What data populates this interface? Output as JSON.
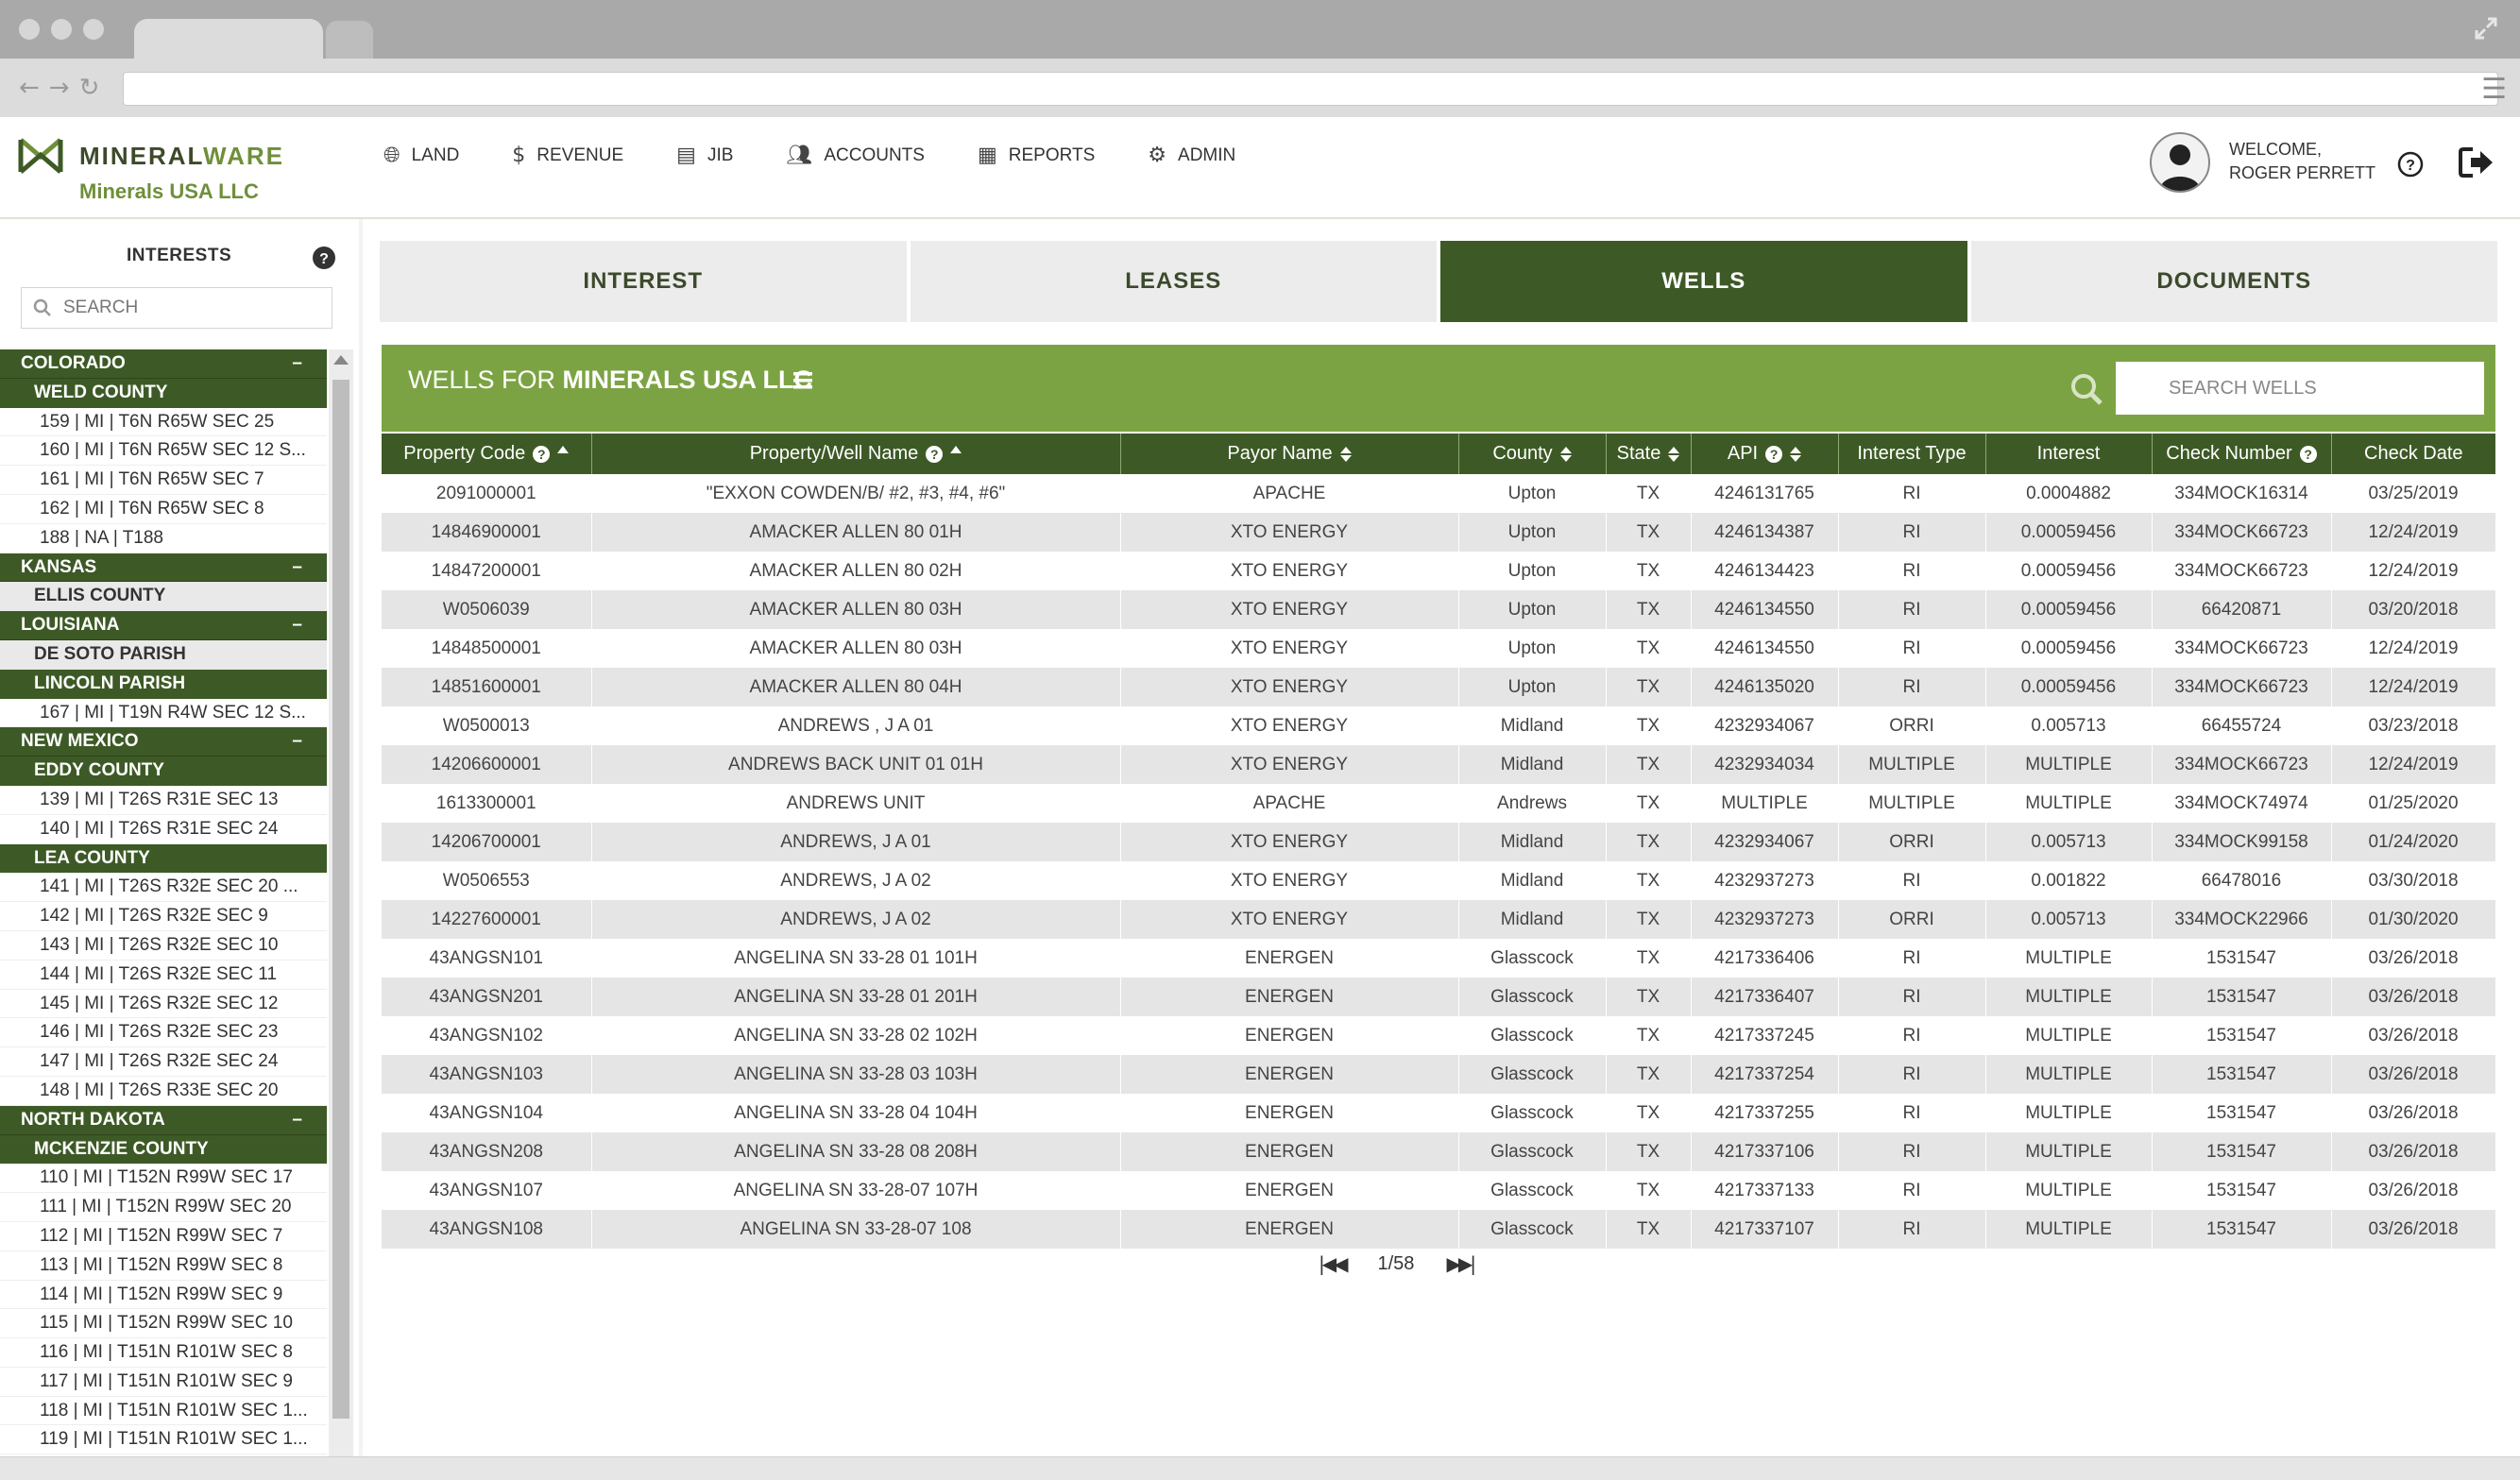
{
  "app": {
    "logo_text_a": "MINERAL",
    "logo_text_b": "WARE",
    "company": "Minerals USA LLC",
    "colors": {
      "primary_dark": "#3d5a26",
      "primary_light": "#7ca343",
      "accent_text": "#6f8f3a"
    }
  },
  "nav": [
    {
      "label": "LAND",
      "icon": "globe-icon"
    },
    {
      "label": "REVENUE",
      "icon": "dollar-icon"
    },
    {
      "label": "JIB",
      "icon": "file-icon"
    },
    {
      "label": "ACCOUNTS",
      "icon": "users-icon"
    },
    {
      "label": "REPORTS",
      "icon": "document-icon"
    },
    {
      "label": "ADMIN",
      "icon": "gear-icon"
    }
  ],
  "user": {
    "welcome": "WELCOME,",
    "name": "ROGER PERRETT"
  },
  "sidebar": {
    "title": "INTERESTS",
    "search_placeholder": "SEARCH",
    "tree": [
      {
        "type": "state",
        "label": "COLORADO"
      },
      {
        "type": "county",
        "label": "WELD COUNTY"
      },
      {
        "type": "leaf",
        "label": "159 | MI | T6N R65W SEC 25"
      },
      {
        "type": "leaf",
        "label": "160 | MI | T6N R65W SEC 12 S..."
      },
      {
        "type": "leaf",
        "label": "161 | MI | T6N R65W SEC 7"
      },
      {
        "type": "leaf",
        "label": "162 | MI | T6N R65W SEC 8"
      },
      {
        "type": "leaf",
        "label": "188 | NA | T188"
      },
      {
        "type": "state",
        "label": "KANSAS"
      },
      {
        "type": "county-light",
        "label": "ELLIS COUNTY"
      },
      {
        "type": "state",
        "label": "LOUISIANA"
      },
      {
        "type": "county-light",
        "label": "DE SOTO PARISH"
      },
      {
        "type": "county",
        "label": "LINCOLN PARISH"
      },
      {
        "type": "leaf",
        "label": "167 | MI | T19N R4W SEC 12 S..."
      },
      {
        "type": "state",
        "label": "NEW MEXICO"
      },
      {
        "type": "county",
        "label": "EDDY COUNTY"
      },
      {
        "type": "leaf",
        "label": "139 | MI | T26S R31E SEC 13"
      },
      {
        "type": "leaf",
        "label": "140 | MI | T26S R31E SEC 24"
      },
      {
        "type": "county",
        "label": "LEA COUNTY"
      },
      {
        "type": "leaf",
        "label": "141 | MI | T26S R32E SEC 20 ..."
      },
      {
        "type": "leaf",
        "label": "142 | MI | T26S R32E SEC 9"
      },
      {
        "type": "leaf",
        "label": "143 | MI | T26S R32E SEC 10"
      },
      {
        "type": "leaf",
        "label": "144 | MI | T26S R32E SEC 11"
      },
      {
        "type": "leaf",
        "label": "145 | MI | T26S R32E SEC 12"
      },
      {
        "type": "leaf",
        "label": "146 | MI | T26S R32E SEC 23"
      },
      {
        "type": "leaf",
        "label": "147 | MI | T26S R32E SEC 24"
      },
      {
        "type": "leaf",
        "label": "148 | MI | T26S R33E SEC 20"
      },
      {
        "type": "state",
        "label": "NORTH DAKOTA"
      },
      {
        "type": "county",
        "label": "MCKENZIE COUNTY"
      },
      {
        "type": "leaf",
        "label": "110 | MI | T152N R99W SEC 17"
      },
      {
        "type": "leaf",
        "label": "111 | MI | T152N R99W SEC 20"
      },
      {
        "type": "leaf",
        "label": "112 | MI | T152N R99W SEC 7"
      },
      {
        "type": "leaf",
        "label": "113 | MI | T152N R99W SEC 8"
      },
      {
        "type": "leaf",
        "label": "114 | MI | T152N R99W SEC 9"
      },
      {
        "type": "leaf",
        "label": "115 | MI | T152N R99W SEC 10"
      },
      {
        "type": "leaf",
        "label": "116 | MI | T151N R101W SEC 8"
      },
      {
        "type": "leaf",
        "label": "117 | MI | T151N R101W SEC 9"
      },
      {
        "type": "leaf",
        "label": "118 | MI | T151N R101W SEC 1..."
      },
      {
        "type": "leaf",
        "label": "119 | MI | T151N R101W SEC 1..."
      }
    ],
    "collapse_symbol": "–"
  },
  "tabs": [
    {
      "label": "INTEREST",
      "active": false
    },
    {
      "label": "LEASES",
      "active": false
    },
    {
      "label": "WELLS",
      "active": true
    },
    {
      "label": "DOCUMENTS",
      "active": false
    }
  ],
  "panel": {
    "title_prefix": "WELLS FOR ",
    "title_bold": "MINERALS USA LLC",
    "search_placeholder": "SEARCH WELLS"
  },
  "table": {
    "columns": [
      {
        "label": "Property Code",
        "help": true,
        "sort": "up"
      },
      {
        "label": "Property/Well Name",
        "help": true,
        "sort": "up"
      },
      {
        "label": "Payor Name",
        "help": false,
        "sort": "both"
      },
      {
        "label": "County",
        "help": false,
        "sort": "both"
      },
      {
        "label": "State",
        "help": false,
        "sort": "both"
      },
      {
        "label": "API",
        "help": true,
        "sort": "both"
      },
      {
        "label": "Interest Type",
        "help": false,
        "sort": "none"
      },
      {
        "label": "Interest",
        "help": false,
        "sort": "none"
      },
      {
        "label": "Check Number",
        "help": true,
        "sort": "none"
      },
      {
        "label": "Check Date",
        "help": false,
        "sort": "none"
      }
    ],
    "rows": [
      [
        "2091000001",
        "\"EXXON COWDEN/B/ #2, #3, #4, #6\"",
        "APACHE",
        "Upton",
        "TX",
        "4246131765",
        "RI",
        "0.0004882",
        "334MOCK16314",
        "03/25/2019"
      ],
      [
        "14846900001",
        "AMACKER ALLEN 80 01H",
        "XTO ENERGY",
        "Upton",
        "TX",
        "4246134387",
        "RI",
        "0.00059456",
        "334MOCK66723",
        "12/24/2019"
      ],
      [
        "14847200001",
        "AMACKER ALLEN 80 02H",
        "XTO ENERGY",
        "Upton",
        "TX",
        "4246134423",
        "RI",
        "0.00059456",
        "334MOCK66723",
        "12/24/2019"
      ],
      [
        "W0506039",
        "AMACKER ALLEN 80 03H",
        "XTO ENERGY",
        "Upton",
        "TX",
        "4246134550",
        "RI",
        "0.00059456",
        "66420871",
        "03/20/2018"
      ],
      [
        "14848500001",
        "AMACKER ALLEN 80 03H",
        "XTO ENERGY",
        "Upton",
        "TX",
        "4246134550",
        "RI",
        "0.00059456",
        "334MOCK66723",
        "12/24/2019"
      ],
      [
        "14851600001",
        "AMACKER ALLEN 80 04H",
        "XTO ENERGY",
        "Upton",
        "TX",
        "4246135020",
        "RI",
        "0.00059456",
        "334MOCK66723",
        "12/24/2019"
      ],
      [
        "W0500013",
        "ANDREWS , J A 01",
        "XTO ENERGY",
        "Midland",
        "TX",
        "4232934067",
        "ORRI",
        "0.005713",
        "66455724",
        "03/23/2018"
      ],
      [
        "14206600001",
        "ANDREWS BACK UNIT 01 01H",
        "XTO ENERGY",
        "Midland",
        "TX",
        "4232934034",
        "MULTIPLE",
        "MULTIPLE",
        "334MOCK66723",
        "12/24/2019"
      ],
      [
        "1613300001",
        "ANDREWS UNIT",
        "APACHE",
        "Andrews",
        "TX",
        "MULTIPLE",
        "MULTIPLE",
        "MULTIPLE",
        "334MOCK74974",
        "01/25/2020"
      ],
      [
        "14206700001",
        "ANDREWS, J A 01",
        "XTO ENERGY",
        "Midland",
        "TX",
        "4232934067",
        "ORRI",
        "0.005713",
        "334MOCK99158",
        "01/24/2020"
      ],
      [
        "W0506553",
        "ANDREWS, J A 02",
        "XTO ENERGY",
        "Midland",
        "TX",
        "4232937273",
        "RI",
        "0.001822",
        "66478016",
        "03/30/2018"
      ],
      [
        "14227600001",
        "ANDREWS, J A 02",
        "XTO ENERGY",
        "Midland",
        "TX",
        "4232937273",
        "ORRI",
        "0.005713",
        "334MOCK22966",
        "01/30/2020"
      ],
      [
        "43ANGSN101",
        "ANGELINA SN 33-28 01 101H",
        "ENERGEN",
        "Glasscock",
        "TX",
        "4217336406",
        "RI",
        "MULTIPLE",
        "1531547",
        "03/26/2018"
      ],
      [
        "43ANGSN201",
        "ANGELINA SN 33-28 01 201H",
        "ENERGEN",
        "Glasscock",
        "TX",
        "4217336407",
        "RI",
        "MULTIPLE",
        "1531547",
        "03/26/2018"
      ],
      [
        "43ANGSN102",
        "ANGELINA SN 33-28 02 102H",
        "ENERGEN",
        "Glasscock",
        "TX",
        "4217337245",
        "RI",
        "MULTIPLE",
        "1531547",
        "03/26/2018"
      ],
      [
        "43ANGSN103",
        "ANGELINA SN 33-28 03 103H",
        "ENERGEN",
        "Glasscock",
        "TX",
        "4217337254",
        "RI",
        "MULTIPLE",
        "1531547",
        "03/26/2018"
      ],
      [
        "43ANGSN104",
        "ANGELINA SN 33-28 04 104H",
        "ENERGEN",
        "Glasscock",
        "TX",
        "4217337255",
        "RI",
        "MULTIPLE",
        "1531547",
        "03/26/2018"
      ],
      [
        "43ANGSN208",
        "ANGELINA SN 33-28 08 208H",
        "ENERGEN",
        "Glasscock",
        "TX",
        "4217337106",
        "RI",
        "MULTIPLE",
        "1531547",
        "03/26/2018"
      ],
      [
        "43ANGSN107",
        "ANGELINA SN 33-28-07 107H",
        "ENERGEN",
        "Glasscock",
        "TX",
        "4217337133",
        "RI",
        "MULTIPLE",
        "1531547",
        "03/26/2018"
      ],
      [
        "43ANGSN108",
        "ANGELINA SN 33-28-07 108",
        "ENERGEN",
        "Glasscock",
        "TX",
        "4217337107",
        "RI",
        "MULTIPLE",
        "1531547",
        "03/26/2018"
      ]
    ]
  },
  "pager": {
    "first": "⏮",
    "prev": "◀◀",
    "page": "1/58",
    "next": "▶▶",
    "last": "⏭"
  }
}
